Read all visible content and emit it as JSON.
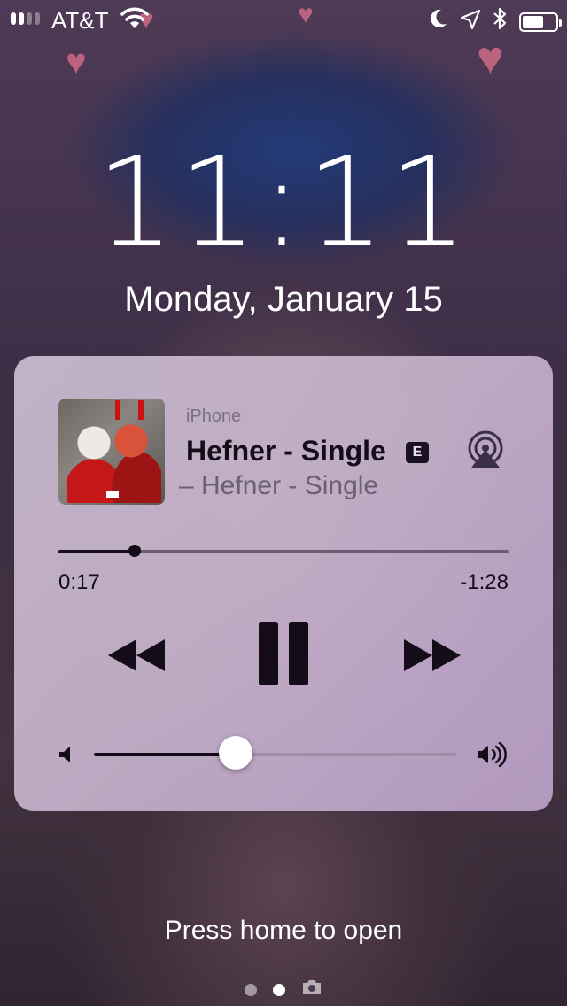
{
  "status_bar": {
    "carrier": "AT&T",
    "signal_bars": 4,
    "signal_active": 2,
    "icons": [
      "wifi-icon",
      "moon-icon",
      "location-icon",
      "bluetooth-icon",
      "battery-icon"
    ],
    "battery_level": 0.65
  },
  "lockscreen": {
    "time": "11:11",
    "date": "Monday, January 15",
    "hint": "Press home to open",
    "pages": [
      "today",
      "home",
      "camera"
    ],
    "active_page": 1
  },
  "now_playing": {
    "device": "iPhone",
    "title": "Hefner - Single",
    "explicit_badge": "E",
    "subtitle": "– Hefner - Single",
    "elapsed": "0:17",
    "remaining": "-1:28",
    "progress": 0.17,
    "volume": 0.39,
    "controls": [
      "rewind",
      "pause",
      "fast-forward"
    ]
  },
  "colors": {
    "card_bg": "#c8b4cd",
    "text_dark": "#140c18",
    "text_muted": "#6b5f72",
    "heart": "#e0708d"
  }
}
